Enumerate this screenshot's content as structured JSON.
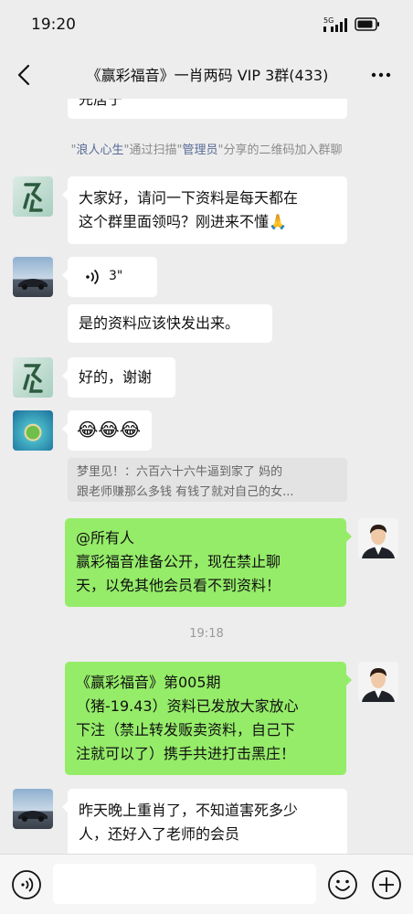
{
  "status_bar": {
    "time": "19:20",
    "network": "5G"
  },
  "header": {
    "title": "《赢彩福音》一肖两码 VIP 3群(433)"
  },
  "messages": {
    "partial_top": "先居于",
    "join_notice": {
      "user": "浪人心生",
      "mid1": "通过扫描",
      "admin": "管理员",
      "mid2": "分享的二维码加入群聊"
    },
    "m1_line1": "大家好，请问一下资料是每天都在",
    "m1_line2": "这个群里面领吗？刚进来不懂🙏",
    "voice_duration": "3\"",
    "m3": "是的资料应该快发出来。",
    "m4": "好的，谢谢",
    "m5_emoji": "😂😂😂",
    "quote_line1": "梦里见！：六百六十六牛逼到家了 妈的",
    "quote_line2": "跟老师赚那么多钱 有钱了就对自己的女...",
    "self1_line1": "@所有人",
    "self1_line2": "赢彩福音准备公开，现在禁止聊",
    "self1_line3": "天，以免其他会员看不到资料！",
    "time_sep": "19:18",
    "self2_line1": "《赢彩福音》第005期",
    "self2_line2": "（猪-19.43）资料已发放大家放心",
    "self2_line3": "下注（禁止转发贩卖资料，自己下",
    "self2_line4": "注就可以了）携手共进打击黑庄！",
    "m8_line1": "昨天晚上重肖了，不知道害死多少",
    "m8_line2": "人，还好入了老师的会员"
  },
  "colors": {
    "background": "#ededed",
    "self_bubble": "#95ec69",
    "link": "#576b95"
  },
  "icons": [
    "back-arrow-icon",
    "more-icon",
    "voice-icon",
    "emoji-icon",
    "plus-icon"
  ]
}
